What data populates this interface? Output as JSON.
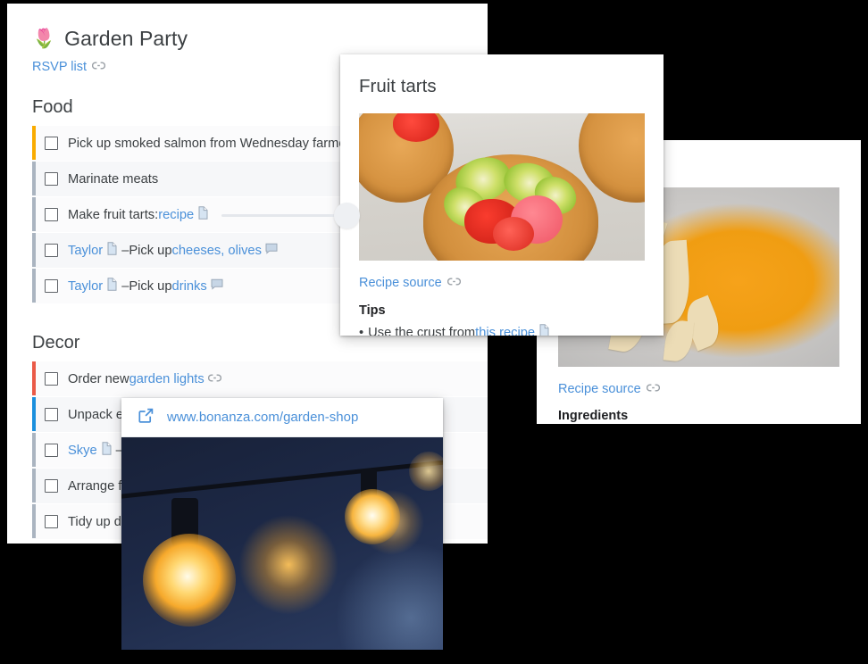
{
  "document": {
    "emoji": "🌷",
    "title": "Garden Party",
    "rsvp_link": "RSVP list",
    "sections": [
      {
        "heading": "Food",
        "items": [
          {
            "accent": "#f9ab00",
            "text": "Pick up smoked salmon from Wednesday farmers market",
            "truncated": true
          },
          {
            "accent": "#aab4c0",
            "text": "Marinate meats"
          },
          {
            "accent": "#aab4c0",
            "prefix": "Make fruit tarts: ",
            "link": "recipe",
            "doc_icon": true
          },
          {
            "accent": "#aab4c0",
            "assignee": "Taylor",
            "doc_icon": true,
            "dash": "–",
            "mid": " Pick up ",
            "link": "cheeses, olives",
            "comment_icon": true
          },
          {
            "accent": "#aab4c0",
            "assignee": "Taylor",
            "doc_icon": true,
            "dash": "–",
            "mid": " Pick up ",
            "link": "drinks",
            "comment_icon": true
          }
        ]
      },
      {
        "heading": "Decor",
        "items": [
          {
            "accent": "#ea5a47",
            "prefix": "Order new ",
            "link": "garden lights",
            "link_icon": true
          },
          {
            "accent": "#1a8fdd",
            "text": "Unpack ex",
            "truncated": true
          },
          {
            "accent": "#aab4c0",
            "assignee": "Skye",
            "doc_icon": true,
            "dash": "–",
            "truncated": true
          },
          {
            "accent": "#aab4c0",
            "text": "Arrange fu",
            "truncated": true
          },
          {
            "accent": "#aab4c0",
            "text": "Tidy up de",
            "truncated": true
          }
        ]
      }
    ]
  },
  "tart_card": {
    "title": "Fruit tarts",
    "image_alt": "fruit tarts with strawberry and kiwi",
    "source_link": "Recipe source",
    "tips_heading": "Tips",
    "tip_bullet": "•",
    "tip_text": "Use the crust from ",
    "tip_link": "this recipe"
  },
  "pie_card": {
    "image_alt": "pumpkin pie with pastry leaves",
    "source_link": "Recipe source",
    "ingredients_heading": "Ingredients"
  },
  "url_card": {
    "url": "www.bonanza.com/garden-shop",
    "image_alt": "string of warm glowing festoon lights at dusk"
  },
  "colors": {
    "link_blue": "#4a90d9",
    "text": "#3c4043",
    "background": "#000000",
    "row_even": "#f6f7f9",
    "row_odd": "#fbfbfc"
  }
}
